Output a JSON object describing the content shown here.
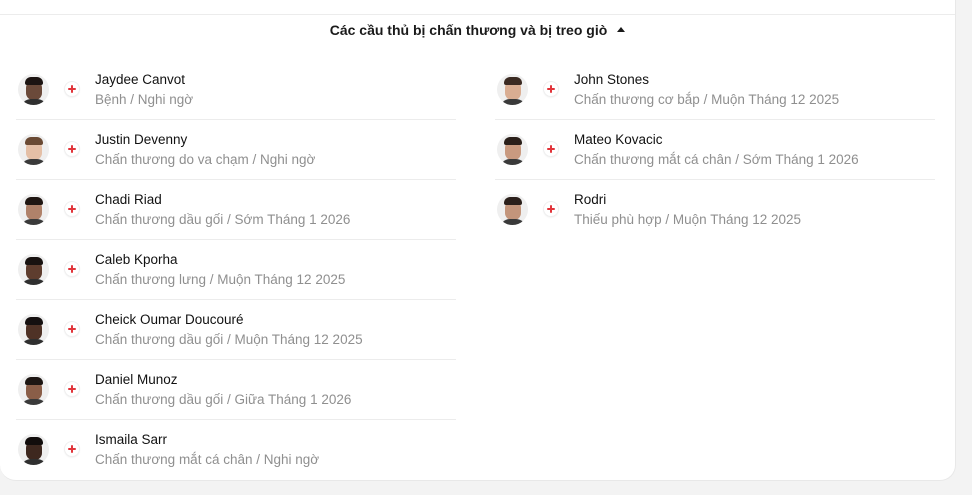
{
  "header": {
    "title": "Các cầu thủ bị chấn thương và bị treo giò"
  },
  "icons": {
    "status": "medical-cross-icon",
    "status_color": "#e1343a",
    "collapse": "caret-up-icon"
  },
  "players_left": [
    {
      "name": "Jaydee Canvot",
      "detail": "Bệnh / Nghi ngờ"
    },
    {
      "name": "Justin Devenny",
      "detail": "Chấn thương do va chạm / Nghi ngờ"
    },
    {
      "name": "Chadi Riad",
      "detail": "Chấn thương dầu gối / Sớm Tháng 1 2026"
    },
    {
      "name": "Caleb Kporha",
      "detail": "Chấn thương lưng / Muộn Tháng 12 2025"
    },
    {
      "name": "Cheick Oumar Doucouré",
      "detail": "Chấn thương dầu gối / Muộn Tháng 12 2025"
    },
    {
      "name": "Daniel Munoz",
      "detail": "Chấn thương dầu gối / Giữa Tháng 1 2026"
    },
    {
      "name": "Ismaila Sarr",
      "detail": "Chấn thương mắt cá chân / Nghi ngờ"
    }
  ],
  "players_right": [
    {
      "name": "John Stones",
      "detail": "Chấn thương cơ bắp / Muộn Tháng 12 2025"
    },
    {
      "name": "Mateo Kovacic",
      "detail": "Chấn thương mắt cá chân / Sớm Tháng 1 2026"
    },
    {
      "name": "Rodri",
      "detail": "Thiếu phù hợp / Muộn Tháng 12 2025"
    }
  ]
}
